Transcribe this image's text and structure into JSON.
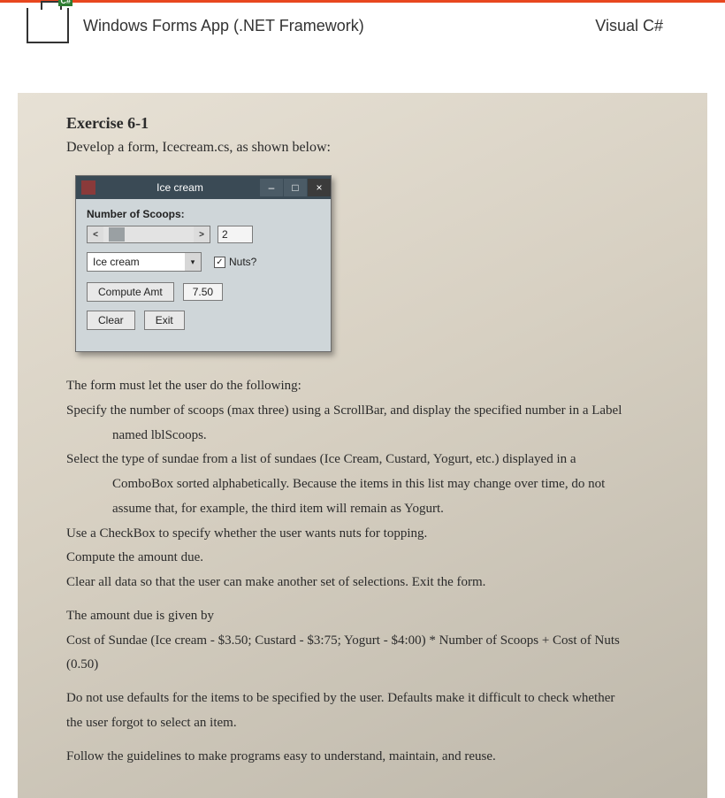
{
  "header": {
    "template_name": "Windows Forms App (.NET Framework)",
    "language": "Visual C#",
    "icon_badge": "C#"
  },
  "exercise": {
    "title": "Exercise 6-1",
    "subtitle": "Develop a form, Icecream.cs, as shown below:"
  },
  "winform": {
    "title": "Ice cream",
    "scoops_label": "Number of Scoops:",
    "scoops_value": "2",
    "combo_selected": "Ice cream",
    "nuts_label": "Nuts?",
    "nuts_checked": true,
    "compute_label": "Compute Amt",
    "amount_value": "7.50",
    "clear_label": "Clear",
    "exit_label": "Exit",
    "min_btn": "–",
    "max_btn": "□",
    "close_btn": "×",
    "scroll_left": "<",
    "scroll_right": ">",
    "combo_arrow": "▾"
  },
  "text": {
    "intro": "The form must let the user do the following:",
    "req1a": "Specify the number of scoops (max three) using a ScrollBar, and display the specified number in a Label",
    "req1b": "named lblScoops.",
    "req2a": "Select the type of sundae from a list of sundaes (Ice Cream, Custard, Yogurt, etc.) displayed in a",
    "req2b": "ComboBox sorted alphabetically. Because the items in this list may change over time, do not",
    "req2c": "assume that, for example, the third item will remain as Yogurt.",
    "req3": "Use a CheckBox to specify whether the user wants nuts for topping.",
    "req4": "Compute the amount due.",
    "req5": "Clear all data so that the user can make another set of selections. Exit the form.",
    "amt1": "The amount due is given by",
    "amt2": "Cost of Sundae (Ice cream - $3.50; Custard - $3:75; Yogurt - $4:00) * Number of Scoops + Cost of Nuts",
    "amt3": "(0.50)",
    "def1": "Do not use defaults for the items to be specified by the user. Defaults make it difficult to check whether",
    "def2": "the user forgot to select an item.",
    "guide": "Follow the guidelines to make programs easy to understand, maintain, and reuse."
  }
}
